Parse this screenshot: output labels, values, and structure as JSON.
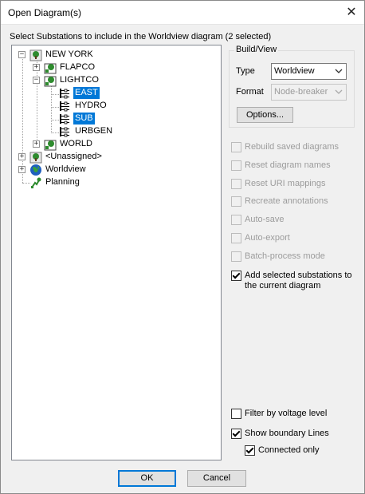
{
  "window": {
    "title": "Open Diagram(s)",
    "close_glyph": "✕"
  },
  "instruction": "Select Substations to include in the Worldview diagram (2 selected)",
  "tree": {
    "items": [
      {
        "label": "NEW YORK",
        "icon": "station-group-icon",
        "expander": "−"
      },
      {
        "label": "FLAPCO",
        "icon": "substation-icon",
        "expander": "+"
      },
      {
        "label": "LIGHTCO",
        "icon": "substation-icon",
        "expander": "−"
      },
      {
        "label": "EAST",
        "icon": "bus-icon",
        "selected": true
      },
      {
        "label": "HYDRO",
        "icon": "bus-icon"
      },
      {
        "label": "SUB",
        "icon": "bus-icon",
        "selected": true
      },
      {
        "label": "URBGEN",
        "icon": "bus-icon"
      },
      {
        "label": "WORLD",
        "icon": "substation-icon",
        "expander": "+"
      },
      {
        "label": "<Unassigned>",
        "icon": "station-group-icon",
        "expander": "+"
      },
      {
        "label": "Worldview",
        "icon": "globe-icon",
        "expander": "+"
      },
      {
        "label": "Planning",
        "icon": "planning-icon"
      }
    ]
  },
  "build_view": {
    "legend": "Build/View",
    "type_label": "Type",
    "type_value": "Worldview",
    "format_label": "Format",
    "format_value": "Node-breaker",
    "options_label": "Options..."
  },
  "options": [
    {
      "label": "Rebuild saved diagrams",
      "checked": false,
      "enabled": false
    },
    {
      "label": "Reset diagram names",
      "checked": false,
      "enabled": false
    },
    {
      "label": "Reset URI mappings",
      "checked": false,
      "enabled": false
    },
    {
      "label": "Recreate annotations",
      "checked": false,
      "enabled": false
    },
    {
      "label": "Auto-save",
      "checked": false,
      "enabled": false
    },
    {
      "label": "Auto-export",
      "checked": false,
      "enabled": false
    },
    {
      "label": "Batch-process mode",
      "checked": false,
      "enabled": false
    },
    {
      "label": "Add selected substations to",
      "label2": "the current diagram",
      "checked": true,
      "enabled": true
    }
  ],
  "bottom_options": [
    {
      "label": "Filter by voltage level",
      "checked": false
    },
    {
      "label": "Show boundary Lines",
      "checked": true
    },
    {
      "label": "Connected only",
      "checked": true
    }
  ],
  "buttons": {
    "ok": "OK",
    "cancel": "Cancel"
  },
  "colors": {
    "selection": "#0078d7",
    "station_green": "#2e8b2e"
  }
}
